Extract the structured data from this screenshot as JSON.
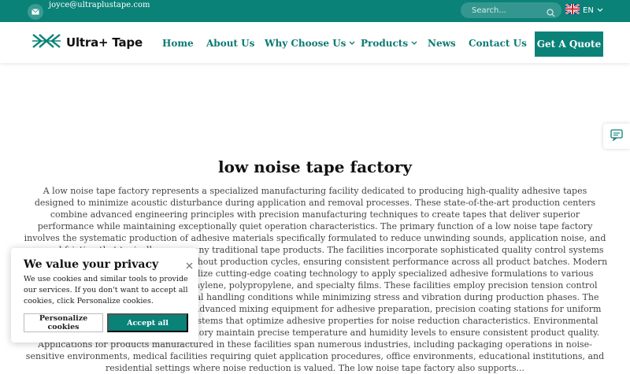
{
  "topbar": {
    "email": "joyce@ultraplustape.com",
    "search_placeholder": "Search...",
    "lang": "EN"
  },
  "header": {
    "logo_text": "Ultra+ Tape",
    "nav": [
      "Home",
      "About Us",
      "Why Choose Us",
      "Products",
      "News",
      "Contact Us"
    ],
    "cta": "Get A Quote"
  },
  "main": {
    "title": "low noise tape factory",
    "body": "A low noise tape factory represents a specialized manufacturing facility dedicated to producing high-quality adhesive tapes designed to minimize acoustic disturbance during application and removal processes. These state-of-the-art production centers combine advanced engineering principles with precision manufacturing techniques to create tapes that deliver superior performance while maintaining exceptionally quiet operation characteristics. The primary function of a low noise tape factory involves the systematic production of adhesive materials specifically formulated to reduce unwinding sounds, application noise, and removal friction that typically accompany traditional tape products. The facilities incorporate sophisticated quality control systems that monitor acoustic properties throughout production cycles, ensuring consistent performance across all product batches. Modern low noise tape factory operations utilize cutting-edge coating technology to apply specialized adhesive formulations to various substrate materials, including polyethylene, polypropylene, and specialty films. These facilities employ precision tension control systems that maintain optimal material handling conditions while minimizing stress and vibration during production phases. The technological infrastructure includes advanced mixing equipment for adhesive preparation, precision coating stations for uniform application, and specialized curing systems that optimize adhesive properties for noise reduction characteristics. Environmental controls within the low noise tape factory maintain precise temperature and humidity levels to ensure consistent product quality. Applications for products manufactured in these facilities span numerous industries, including packaging operations in noise-sensitive environments, medical facilities requiring quiet application procedures, office environments, educational institutions, and residential settings where noise reduction is valued. The low noise tape factory also supports..."
  },
  "cookie": {
    "title": "We value your privacy",
    "description": "We use cookies and similar tools to provide our services. If you don't want to accept all cookies, click Personalize cookies.",
    "personalize_label": "Personalize cookies",
    "accept_label": "Accept all"
  },
  "colors": {
    "brand": "#0a8278",
    "text": "#444444"
  },
  "icons": [
    "mail-icon",
    "search-icon",
    "uk-flag-icon",
    "chevron-down-icon",
    "chat-icon",
    "close-icon"
  ]
}
